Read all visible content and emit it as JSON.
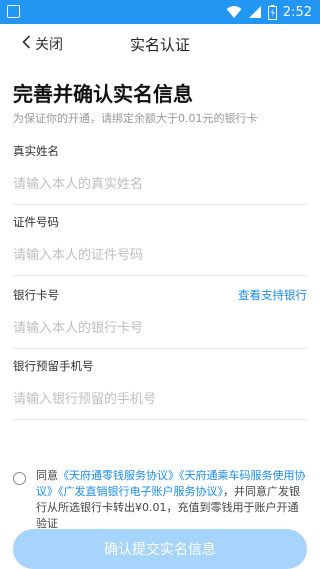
{
  "status_bar": {
    "time": "2:52"
  },
  "nav": {
    "back_label": "关闭",
    "title": "实名认证"
  },
  "heading": "完善并确认实名信息",
  "subheading": "为保证你的开通，请绑定余额大于0.01元的银行卡",
  "fields": [
    {
      "label": "真实姓名",
      "placeholder": "请输入本人的真实姓名"
    },
    {
      "label": "证件号码",
      "placeholder": "请输入本人的证件号码"
    },
    {
      "label": "银行卡号",
      "placeholder": "请输入本人的银行卡号",
      "link": "查看支持银行"
    },
    {
      "label": "银行预留手机号",
      "placeholder": "请输入银行预留的手机号"
    }
  ],
  "agreement": {
    "prefix": "同意",
    "link1": "《天府通零钱服务协议》",
    "link2": "《天府通乘车码服务使用协议》",
    "link3": "《广发直销银行电子账户服务协议》",
    "suffix": "，并同意广发银行从所选银行卡转出¥0.01，充值到零钱用于账户开通验证"
  },
  "submit_label": "确认提交实名信息",
  "colors": {
    "status_bar": "#2196f3",
    "link": "#1e8ce8",
    "button": "#a6d4fa"
  }
}
